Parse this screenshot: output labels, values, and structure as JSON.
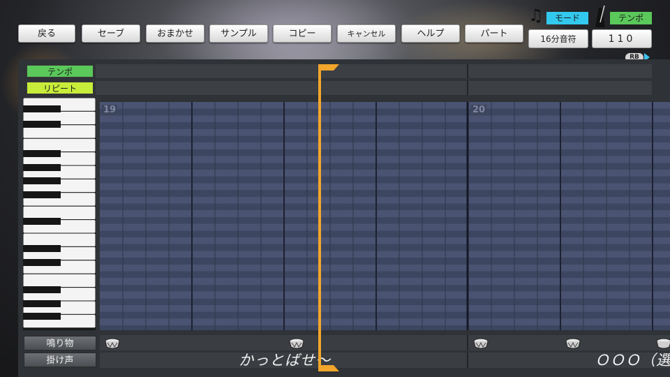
{
  "toolbar": {
    "buttons": [
      {
        "id": "back",
        "label": "戻る"
      },
      {
        "id": "save",
        "label": "セーブ"
      },
      {
        "id": "auto",
        "label": "おまかせ"
      },
      {
        "id": "sample",
        "label": "サンプル"
      },
      {
        "id": "copy",
        "label": "コピー"
      },
      {
        "id": "cancel",
        "label": "キャンセル"
      },
      {
        "id": "help",
        "label": "ヘルプ"
      },
      {
        "id": "part",
        "label": "パート"
      }
    ]
  },
  "mode": {
    "label": "モード",
    "value": "16分音符"
  },
  "tempo": {
    "label": "テンポ",
    "value": "110"
  },
  "shoulder_hint": "RB",
  "tracks": {
    "tempo_label": "テンポ",
    "repeat_label": "リピート"
  },
  "measures": [
    19,
    20
  ],
  "bottom": {
    "sfx_label": "鳴り物",
    "voice_label": "掛け声",
    "voice_texts": [
      "かっとばせ〜",
      "ＯＯＯ（選"
    ]
  },
  "colors": {
    "mode_tag": "#33c8ee",
    "tempo_tag": "#5ac85a",
    "repeat_tag": "#c8ec3a",
    "playhead": "#f2a62c",
    "grid_light": "#4a5472",
    "grid_dark": "#3d4660"
  },
  "icons": [
    "music-note-icon",
    "metronome-icon",
    "drum-icon"
  ]
}
